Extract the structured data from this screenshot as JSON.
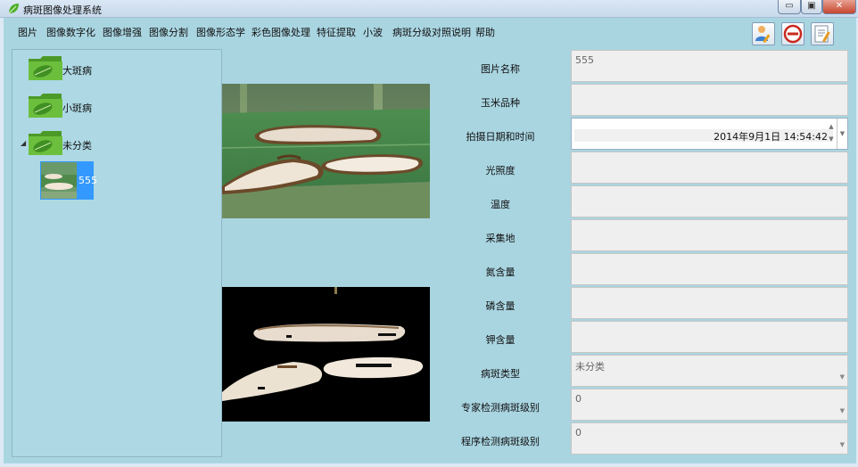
{
  "window": {
    "title": "病斑图像处理系统",
    "buttons": {
      "minimize": "▭",
      "maximize": "▣",
      "close": "✕"
    }
  },
  "menu": [
    "图片",
    "图像数字化",
    "图像增强",
    "图像分割",
    "图像形态学",
    "彩色图像处理",
    "特征提取",
    "小波",
    "病斑分级对照说明",
    "帮助"
  ],
  "toolbar": {
    "icons": [
      "user-edit-icon",
      "exit-icon",
      "report-edit-icon"
    ]
  },
  "tree": {
    "nodes": [
      {
        "label": "大斑病",
        "icon": "folder-leaf-icon"
      },
      {
        "label": "小斑病",
        "icon": "folder-leaf-icon"
      },
      {
        "label": "未分类",
        "icon": "folder-leaf-icon",
        "expanded": true
      }
    ],
    "expander": "◢",
    "child": {
      "label": "555"
    }
  },
  "form": {
    "fields": [
      {
        "label": "图片名称",
        "value": "555"
      },
      {
        "label": "玉米品种",
        "value": ""
      },
      {
        "label": "拍摄日期和时间",
        "value": "2014年9月1日 14:54:42"
      },
      {
        "label": "光照度",
        "value": ""
      },
      {
        "label": "温度",
        "value": ""
      },
      {
        "label": "采集地",
        "value": ""
      },
      {
        "label": "氮含量",
        "value": ""
      },
      {
        "label": "磷含量",
        "value": ""
      },
      {
        "label": "钾含量",
        "value": ""
      },
      {
        "label": "病斑类型",
        "value": "未分类"
      },
      {
        "label": "专家检测病斑级别",
        "value": "0"
      },
      {
        "label": "程序检测病斑级别",
        "value": "0"
      }
    ]
  },
  "colors": {
    "background": "#a9d5e1",
    "tree_background": "#add8e4",
    "selection": "#3399ff",
    "folder": "#5aa832"
  }
}
